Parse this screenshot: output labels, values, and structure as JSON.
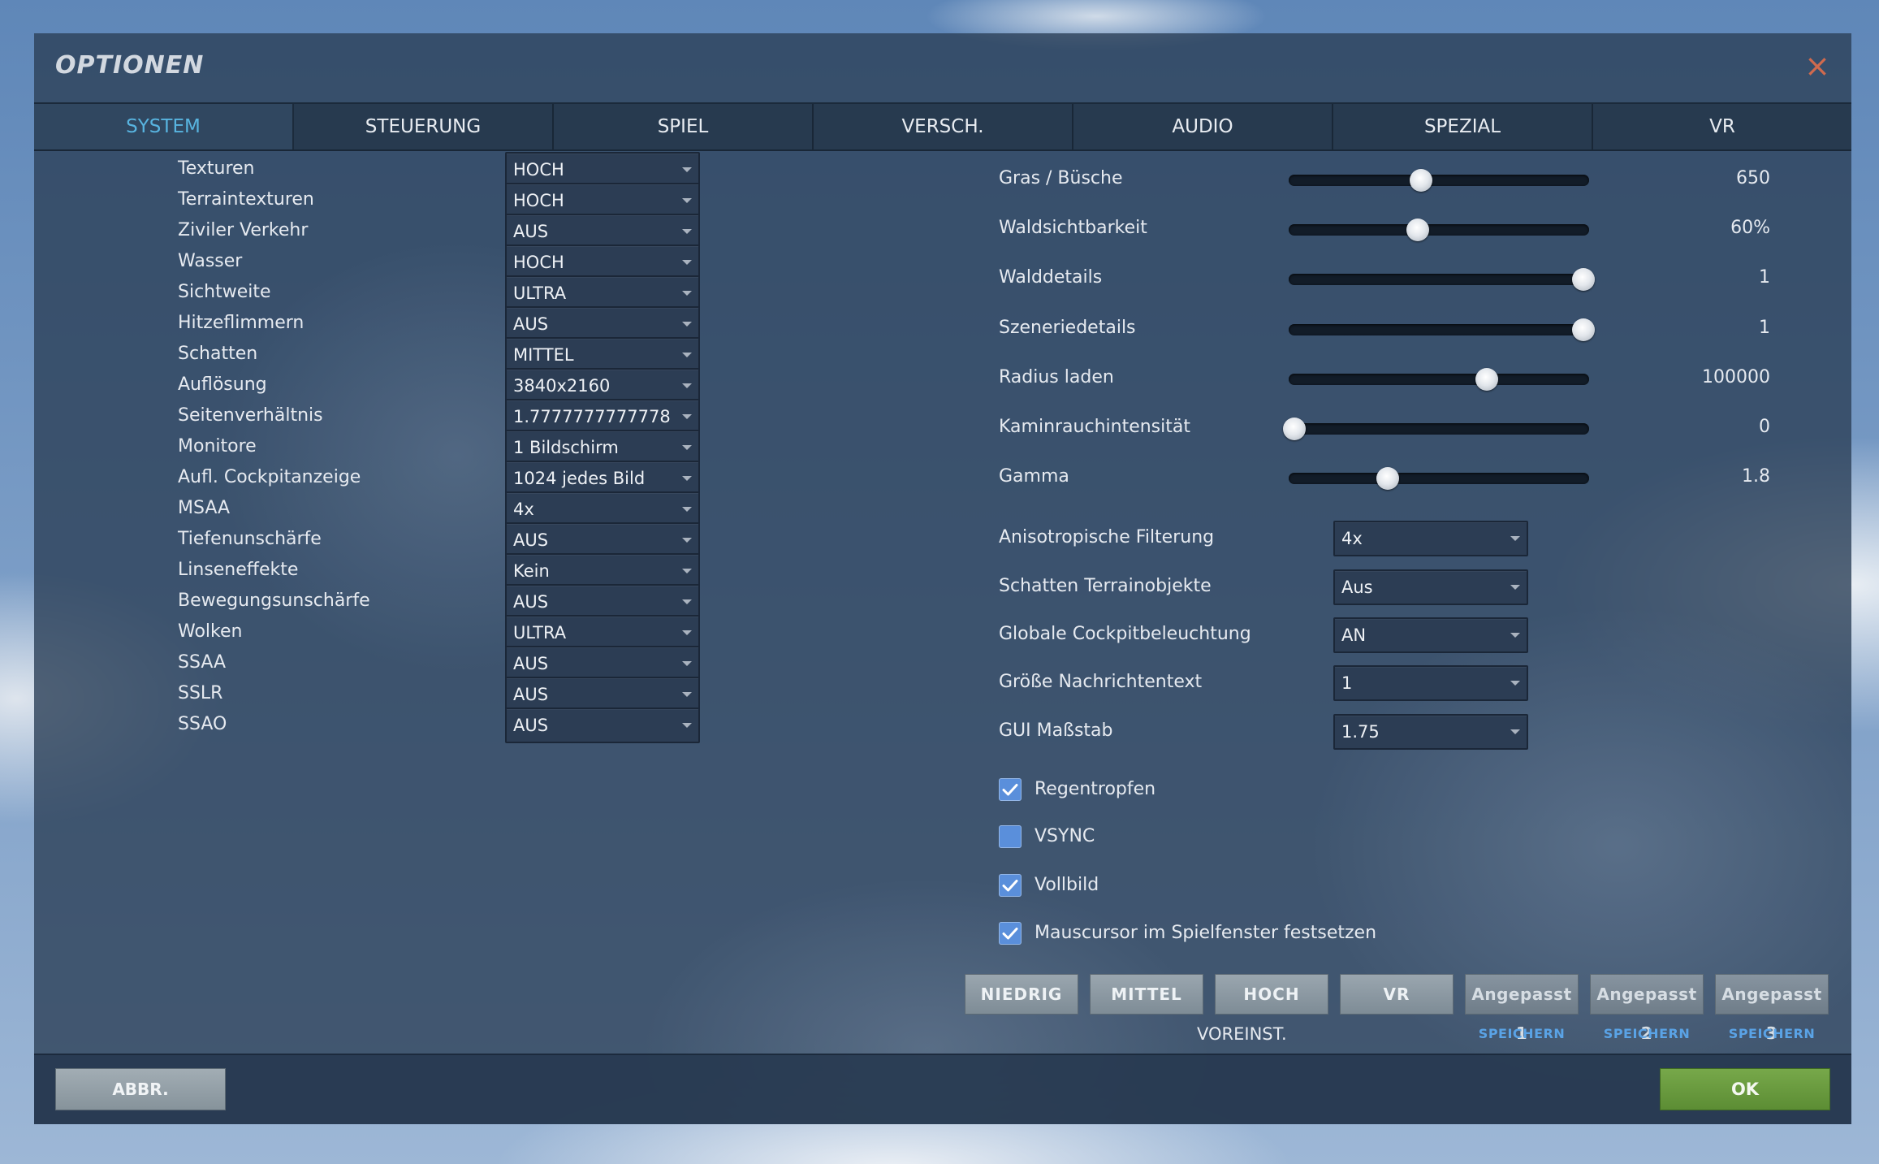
{
  "dialog": {
    "title": "OPTIONEN",
    "close_glyph": "×"
  },
  "tabs": [
    {
      "label": "SYSTEM",
      "active": true
    },
    {
      "label": "STEUERUNG"
    },
    {
      "label": "SPIEL"
    },
    {
      "label": "VERSCH."
    },
    {
      "label": "AUDIO"
    },
    {
      "label": "SPEZIAL"
    },
    {
      "label": "VR"
    }
  ],
  "left_settings": [
    {
      "label": "Texturen",
      "value": "HOCH"
    },
    {
      "label": "Terraintexturen",
      "value": "HOCH"
    },
    {
      "label": "Ziviler Verkehr",
      "value": "AUS"
    },
    {
      "label": "Wasser",
      "value": "HOCH"
    },
    {
      "label": "Sichtweite",
      "value": "ULTRA"
    },
    {
      "label": "Hitzeflimmern",
      "value": "AUS"
    },
    {
      "label": "Schatten",
      "value": "MITTEL"
    },
    {
      "label": "Auflösung",
      "value": "3840x2160"
    },
    {
      "label": "Seitenverhältnis",
      "value": "1.7777777777778"
    },
    {
      "label": "Monitore",
      "value": "1 Bildschirm"
    },
    {
      "label": "Aufl. Cockpitanzeige",
      "value": "1024 jedes Bild"
    },
    {
      "label": "MSAA",
      "value": "4x"
    },
    {
      "label": "Tiefenunschärfe",
      "value": "AUS"
    },
    {
      "label": "Linseneffekte",
      "value": "Kein"
    },
    {
      "label": "Bewegungsunschärfe",
      "value": "AUS"
    },
    {
      "label": "Wolken",
      "value": "ULTRA"
    },
    {
      "label": "SSAA",
      "value": "AUS"
    },
    {
      "label": "SSLR",
      "value": "AUS"
    },
    {
      "label": "SSAO",
      "value": "AUS"
    }
  ],
  "sliders": [
    {
      "label": "Gras / Büsche",
      "value": "650",
      "level": 0.44
    },
    {
      "label": "Waldsichtbarkeit",
      "value": "60%",
      "level": 0.43
    },
    {
      "label": "Walddetails",
      "value": "1",
      "level": 0.98
    },
    {
      "label": "Szeneriedetails",
      "value": "1",
      "level": 0.98
    },
    {
      "label": "Radius laden",
      "value": "100000",
      "level": 0.66
    },
    {
      "label": "Kaminrauchintensität",
      "value": "0",
      "level": 0.02
    },
    {
      "label": "Gamma",
      "value": "1.8",
      "level": 0.33
    }
  ],
  "right_dropdowns": [
    {
      "label": "Anisotropische Filterung",
      "value": "4x"
    },
    {
      "label": "Schatten Terrainobjekte",
      "value": "Aus"
    },
    {
      "label": "Globale Cockpitbeleuchtung",
      "value": "AN"
    },
    {
      "label": "Größe Nachrichtentext",
      "value": "1"
    },
    {
      "label": "GUI Maßstab",
      "value": "1.75"
    }
  ],
  "checkboxes": [
    {
      "label": "Regentropfen",
      "checked": true
    },
    {
      "label": "VSYNC",
      "checked": false
    },
    {
      "label": "Vollbild",
      "checked": true
    },
    {
      "label": "Mauscursor im Spielfenster festsetzen",
      "checked": true
    }
  ],
  "presets": {
    "buttons": [
      "NIEDRIG",
      "MITTEL",
      "HOCH",
      "VR"
    ],
    "custom": [
      "Angepasst 1",
      "Angepasst 2",
      "Angepasst 3"
    ],
    "save_label": "SPEICHERN",
    "group_label": "VOREINST."
  },
  "footer": {
    "cancel_label": "ABBR.",
    "ok_label": "OK"
  },
  "colors": {
    "active_tab": "#58b4e0",
    "ok_button": "#6a9b3e",
    "close_icon": "#d06a4e",
    "checkbox": "#5a8fdb"
  }
}
